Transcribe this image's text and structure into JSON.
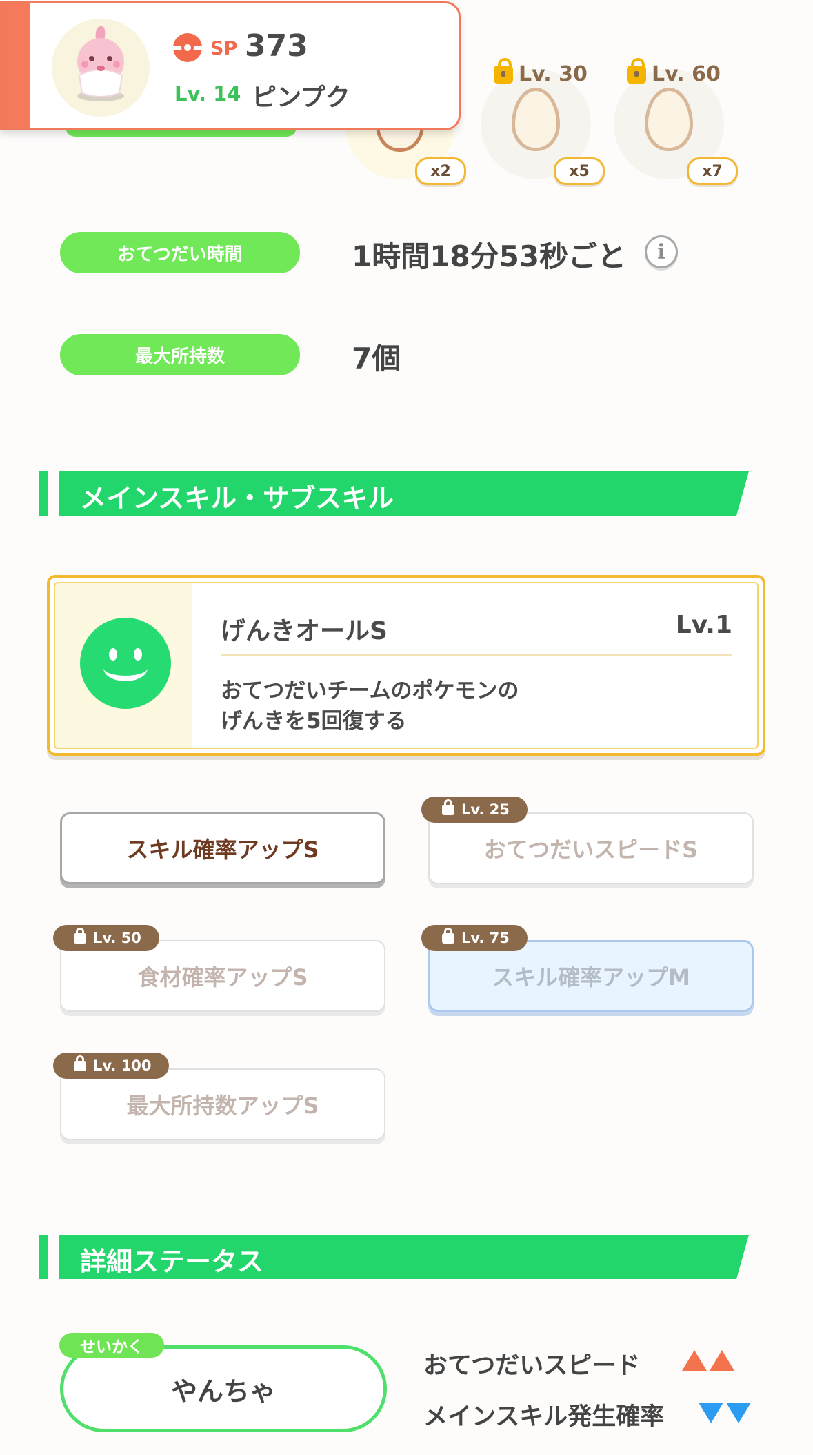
{
  "slots": [
    {
      "locked_level": "",
      "count": "x2"
    },
    {
      "locked_level": "Lv. 30",
      "count": "x5"
    },
    {
      "locked_level": "Lv. 60",
      "count": "x7"
    }
  ],
  "pokemon": {
    "sp_label": "SP",
    "sp_value": "373",
    "level": "Lv. 14",
    "name": "ピンプク"
  },
  "info": {
    "help_time_label": "おてつだい時間",
    "help_time_value": "1時間18分53秒ごと",
    "max_carry_label": "最大所持数",
    "max_carry_value": "7個"
  },
  "skills_section": {
    "title": "メインスキル・サブスキル",
    "main_skill": {
      "name": "げんきオールS",
      "level": "Lv.1",
      "desc_line1": "おてつだいチームのポケモンの",
      "desc_line2": "げんきを5回復する"
    },
    "sub_skills": [
      {
        "label": "スキル確率アップS",
        "unlock": ""
      },
      {
        "label": "おてつだいスピードS",
        "unlock": "Lv. 25"
      },
      {
        "label": "食材確率アップS",
        "unlock": "Lv. 50"
      },
      {
        "label": "スキル確率アップM",
        "unlock": "Lv. 75"
      },
      {
        "label": "最大所持数アップS",
        "unlock": "Lv. 100"
      }
    ]
  },
  "status_section": {
    "title": "詳細ステータス",
    "nature_tag": "せいかく",
    "nature_value": "やんちゃ",
    "stat_up_label": "おてつだいスピード",
    "stat_down_label": "メインスキル発生確率"
  },
  "colors": {
    "accent_green": "#22d66c",
    "pill_green": "#70e857",
    "card_orange": "#f47a5b",
    "stat_up": "#f4734f",
    "stat_down": "#2c9cf2"
  }
}
